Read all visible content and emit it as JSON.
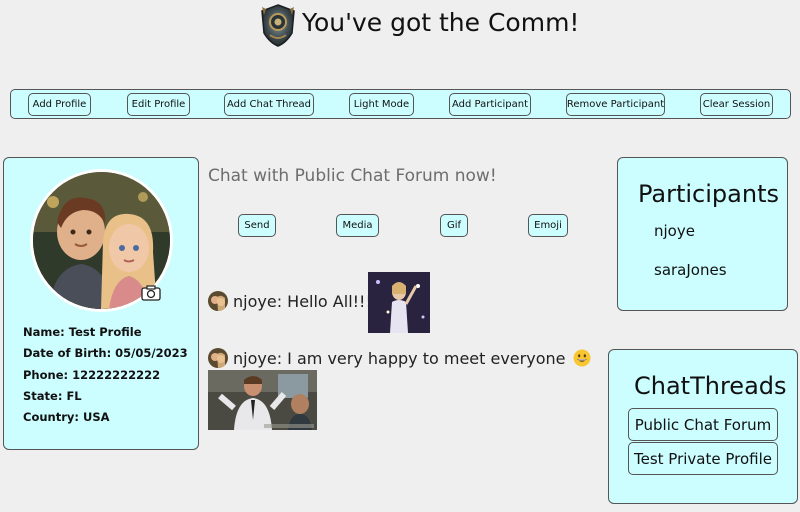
{
  "app": {
    "title": "You've got the Comm!",
    "logo_icon": "shield-emblem-icon"
  },
  "toolbar": {
    "buttons": [
      {
        "label": "Add Profile"
      },
      {
        "label": "Edit Profile"
      },
      {
        "label": "Add Chat Thread"
      },
      {
        "label": "Light Mode"
      },
      {
        "label": "Add Participant"
      },
      {
        "label": "Remove Participant"
      },
      {
        "label": "Clear Session"
      }
    ]
  },
  "profile": {
    "avatar_icon": "profile-avatar-image",
    "camera_icon": "camera-icon",
    "name": "Name: Test Profile",
    "dob": "Date of Birth: 05/05/2023",
    "phone": "Phone: 12222222222",
    "state": "State: FL",
    "country": "Country: USA"
  },
  "chat": {
    "title": "Chat with Public Chat Forum now!",
    "actions": [
      {
        "label": "Send"
      },
      {
        "label": "Media"
      },
      {
        "label": "Gif"
      },
      {
        "label": "Emoji"
      }
    ],
    "messages": [
      {
        "text": "njoye: Hello All!!!",
        "attachment": "gif-image"
      },
      {
        "text": "njoye: I am very happy to meet everyone",
        "emoji": "grinning-face-emoji",
        "attachment": "gif-image"
      }
    ]
  },
  "participants": {
    "title": "Participants",
    "items": [
      "njoye",
      "saraJones"
    ]
  },
  "threads": {
    "title": "ChatThreads",
    "items": [
      "Public Chat Forum",
      "Test Private Profile"
    ]
  },
  "colors": {
    "panel": "#ccfdff",
    "background": "#efefef",
    "border": "#555555"
  }
}
